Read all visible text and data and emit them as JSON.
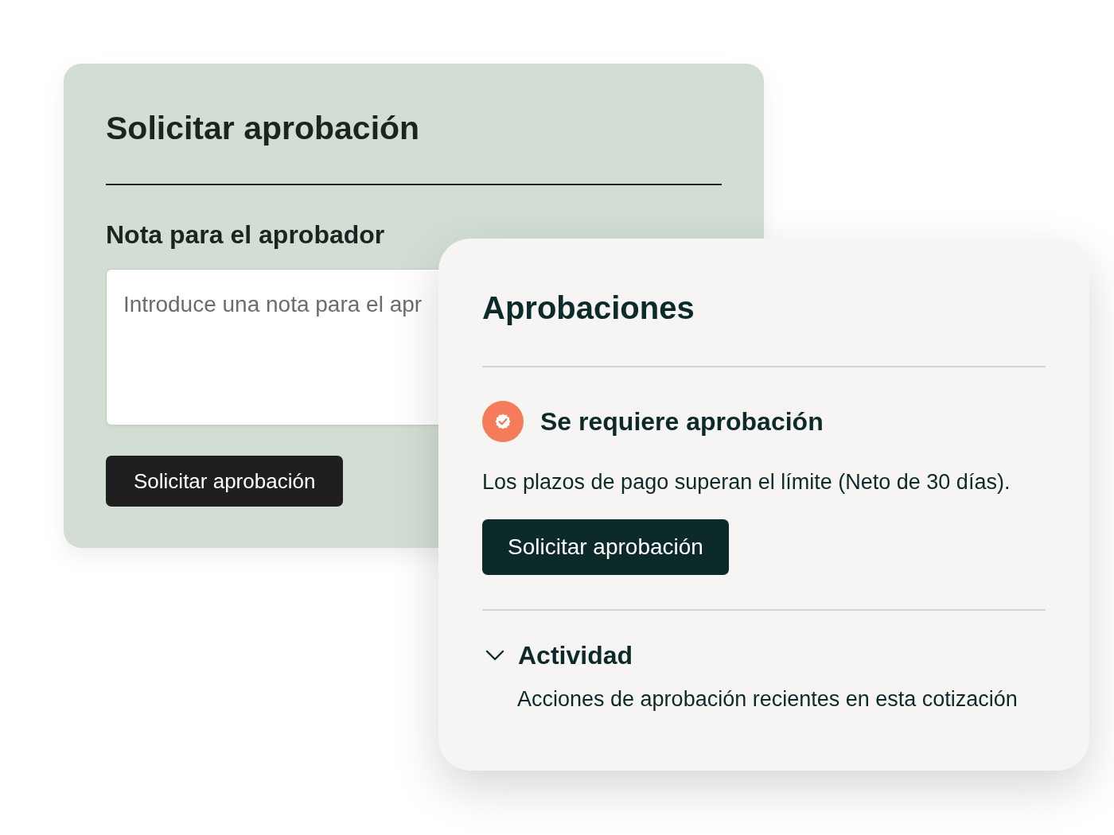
{
  "request_form": {
    "title": "Solicitar aprobación",
    "note_label": "Nota para el aprobador",
    "note_field": {
      "placeholder": "Introduce una nota para el apr"
    },
    "submit_button": "Solicitar aprobación"
  },
  "approvals_panel": {
    "title": "Aprobaciones",
    "status": {
      "title": "Se requiere aprobación",
      "description": "Los plazos de pago superan el límite (Neto de 30 días)."
    },
    "request_button": "Solicitar aprobación",
    "activity": {
      "title": "Actividad",
      "expanded": true,
      "description": "Acciones de aprobación recientes en esta cotización"
    }
  }
}
